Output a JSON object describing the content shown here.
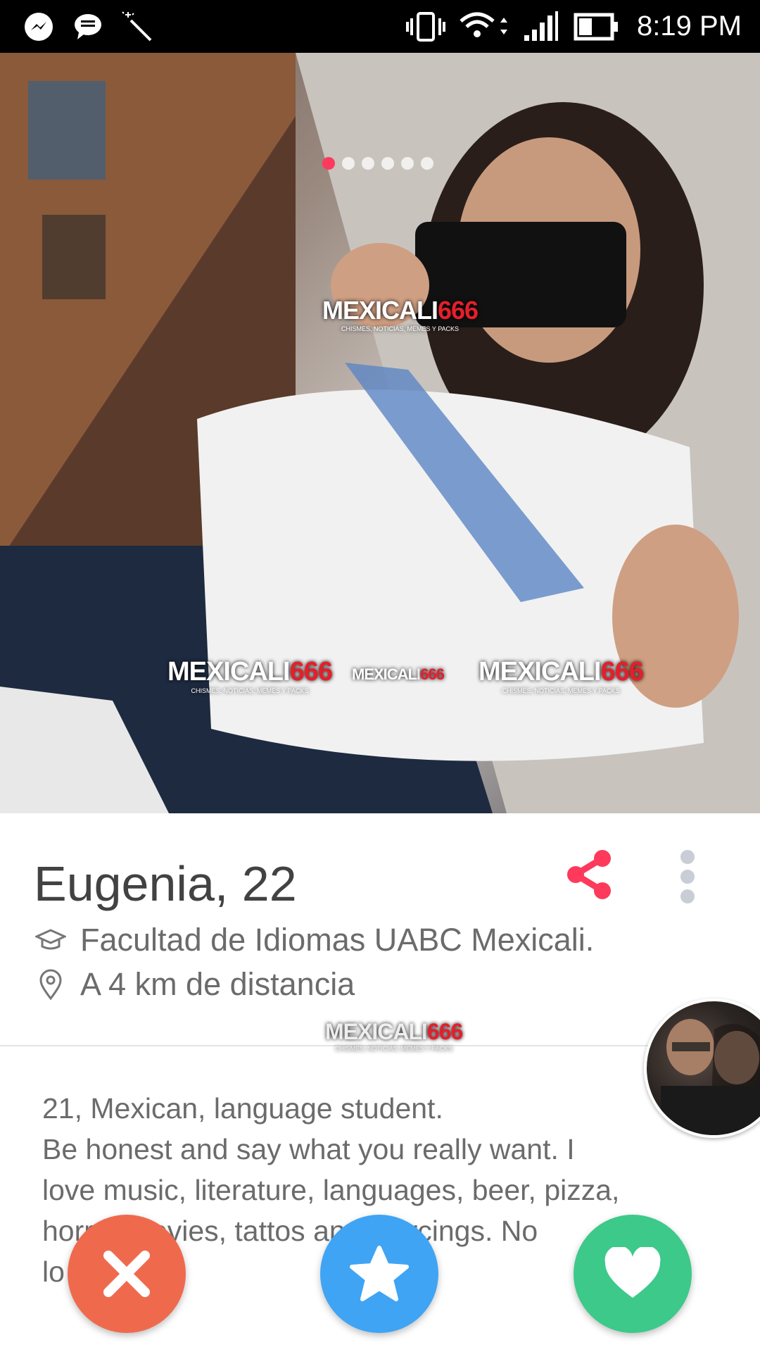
{
  "status_bar": {
    "time": "8:19 PM",
    "icons": [
      "messenger-icon",
      "chat-icon",
      "magic-wand-icon",
      "vibrate-icon",
      "wifi-icon",
      "signal-icon",
      "battery-icon"
    ]
  },
  "photo": {
    "page_count": 6,
    "active_index": 0,
    "watermark_brand": "MEXICALI",
    "watermark_number": "666",
    "watermark_tagline": "CHISMES, NOTICIAS, MEMES Y PACKS"
  },
  "profile": {
    "name_age": "Eugenia, 22",
    "school": "Facultad de Idiomas UABC Mexicali.",
    "distance": "A 4 km de distancia"
  },
  "bio": {
    "lines": [
      "21, Mexican, language student.",
      "Be honest and say what you really want. I",
      "love music, literature, languages, beer, pizza,",
      "horror movies, tattos and piercings. No",
      "lo"
    ]
  },
  "actions": {
    "nope": "nope-icon",
    "super_like": "star-icon",
    "like": "heart-icon"
  },
  "colors": {
    "accent": "#fd3a5c",
    "nope": "#ef6a4d",
    "super_like": "#3fa4f4",
    "like": "#3dc98a"
  }
}
